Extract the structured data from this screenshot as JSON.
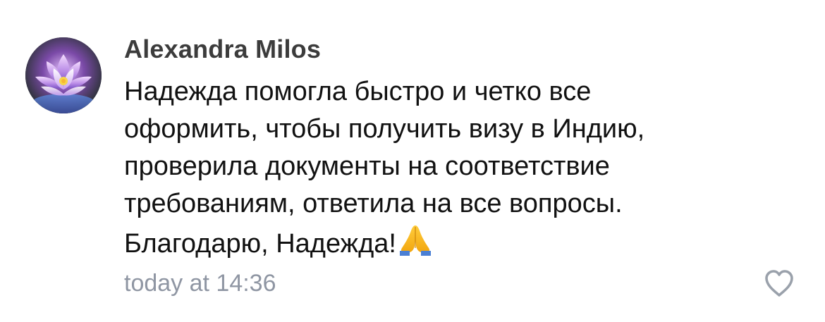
{
  "comment": {
    "author": "Alexandra Milos",
    "text_lines": [
      "Надежда помогла быстро и четко все",
      "оформить, чтобы получить визу в Индию,",
      "проверила документы на соответствие",
      "требованиям, ответила на все вопросы.",
      "Благодарю, Надежда!"
    ],
    "emoji": "folded-hands",
    "timestamp": "today at 14:36",
    "avatar_icon": "lotus-flower",
    "like_icon": "heart-outline-icon"
  },
  "colors": {
    "author": "#3c3c3c",
    "text": "#111111",
    "timestamp": "#8f96a3",
    "icon": "#9aa1ab"
  }
}
